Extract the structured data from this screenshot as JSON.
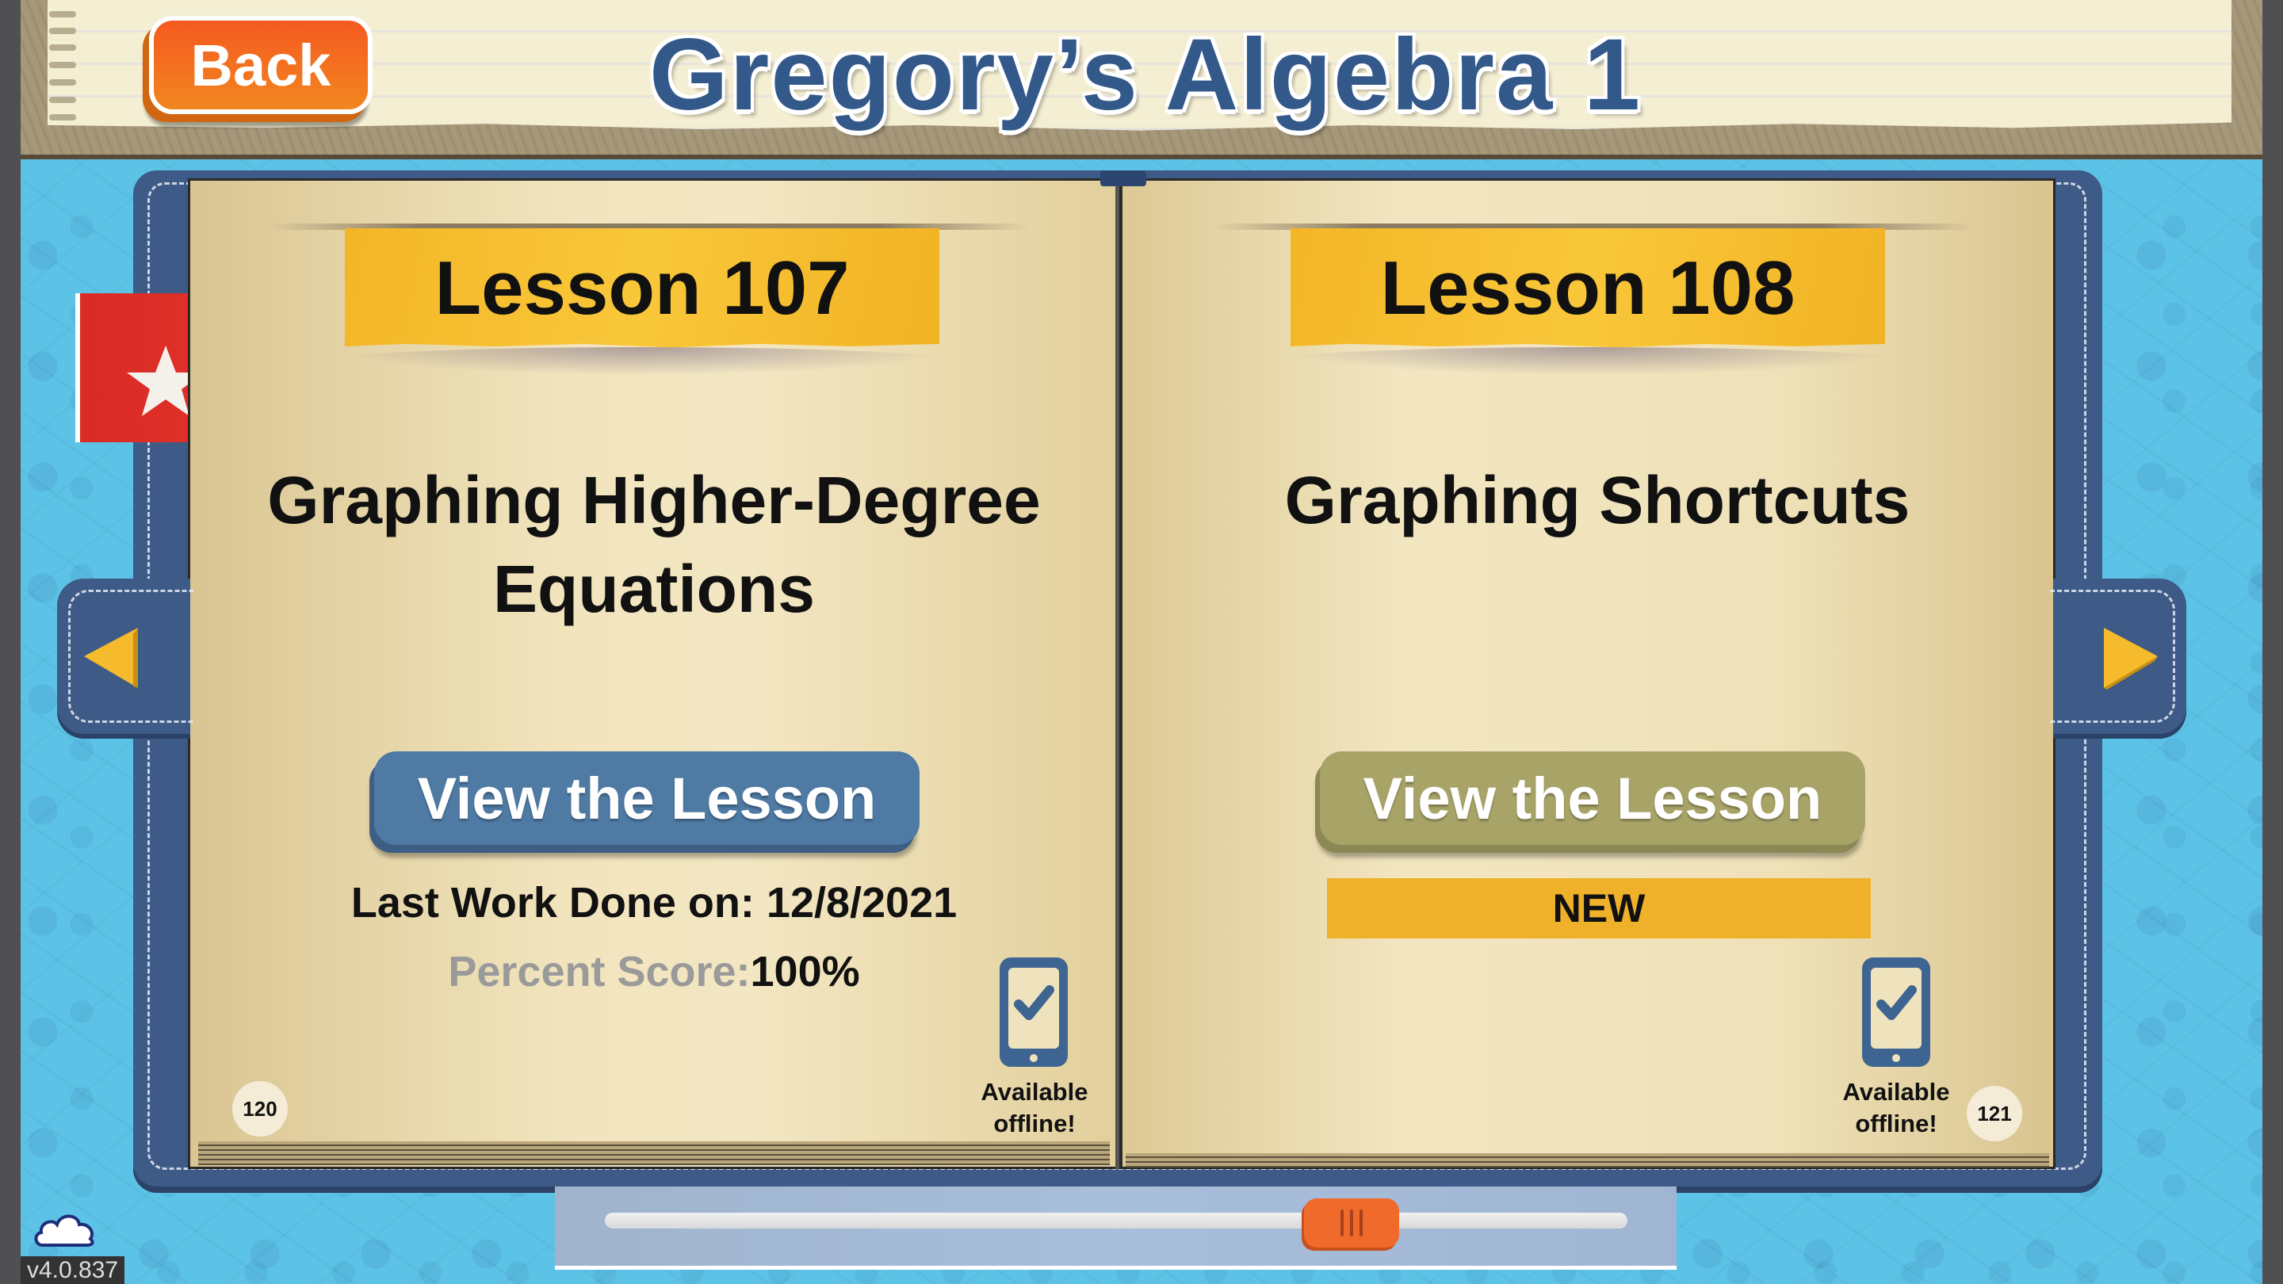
{
  "header": {
    "back_label": "Back",
    "title": "Gregory’s Algebra 1"
  },
  "book": {
    "left_page": {
      "lesson_label": "Lesson 107",
      "lesson_title_line1": "Graphing Higher-Degree",
      "lesson_title_line2": "Equations",
      "view_button_label": "View the Lesson",
      "last_work_label": "Last Work Done on:",
      "last_work_date": "12/8/2021",
      "score_label": "Percent Score:",
      "score_value": "100%",
      "offline_line1": "Available",
      "offline_line2": "offline!",
      "page_number": "120",
      "bookmarked": true,
      "offline_icon": "phone-check-icon"
    },
    "right_page": {
      "lesson_label": "Lesson 108",
      "lesson_title_line1": "Graphing Shortcuts",
      "view_button_label": "View the Lesson",
      "status_badge": "NEW",
      "offline_line1": "Available",
      "offline_line2": "offline!",
      "page_number": "121",
      "offline_icon": "phone-check-icon"
    }
  },
  "navigation": {
    "prev_icon": "triangle-left-icon",
    "next_icon": "triangle-right-icon",
    "slider_position": 0.73
  },
  "footer": {
    "sync_icon": "cloud-icon",
    "version": "v4.0.837"
  },
  "colors": {
    "background_blue": "#5cc3e6",
    "cover_blue": "#3e5a87",
    "title_blue": "#33598a",
    "back_orange": "#f26a21",
    "ribbon_yellow": "#f6be2f",
    "view_button_active": "#4e7aa4",
    "view_button_new": "#a8a468",
    "new_badge": "#efb02a",
    "bookmark_red": "#dd2d28",
    "slider_thumb": "#f06a2c"
  }
}
